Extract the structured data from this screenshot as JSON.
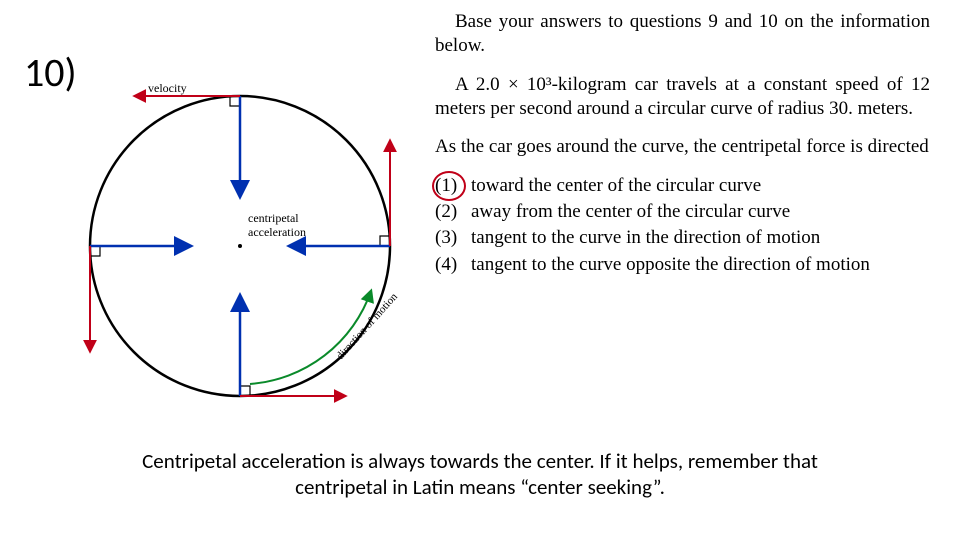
{
  "question_number": "10)",
  "diagram_labels": {
    "velocity": "velocity",
    "centripetal_line1": "centripetal",
    "centripetal_line2": "acceleration",
    "direction_of_motion": "direction of motion"
  },
  "instruction": "Base your answers to questions 9 and 10 on the information below.",
  "given": "A 2.0 × 10³-kilogram car travels at a constant speed of 12 meters per second around a circular curve of radius 30. meters.",
  "prompt": "As the car goes around the curve, the centripetal force is directed",
  "choices": [
    {
      "n": "(1)",
      "text": "toward the center of the circular curve",
      "circled": true
    },
    {
      "n": "(2)",
      "text": "away from the center of the circular curve",
      "circled": false
    },
    {
      "n": "(3)",
      "text": "tangent to the curve in the direction of motion",
      "circled": false
    },
    {
      "n": "(4)",
      "text": "tangent to the curve opposite the direction of motion",
      "circled": false
    }
  ],
  "explanation": "Centripetal acceleration is always towards the center. If it helps, remember that centripetal in Latin means “center seeking”."
}
